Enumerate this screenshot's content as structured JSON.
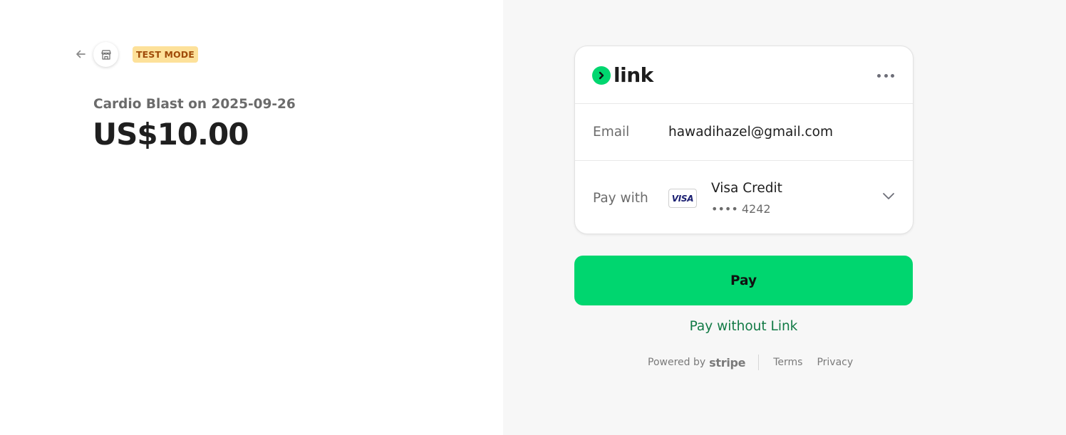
{
  "header": {
    "back_icon": "arrow-left-icon",
    "store_icon": "storefront-icon",
    "badge": "TEST MODE"
  },
  "summary": {
    "product": "Cardio Blast on 2025-09-26",
    "amount": "US$10.00"
  },
  "link_card": {
    "logo_text": "link",
    "menu_icon": "more-dots-icon",
    "email_label": "Email",
    "email_value": "hawadihazel@gmail.com",
    "pay_with_label": "Pay with",
    "card_brand": "VISA",
    "card_name": "Visa Credit",
    "card_last4": "•••• 4242",
    "chevron_icon": "chevron-down-icon"
  },
  "actions": {
    "pay_label": "Pay",
    "pay_without_link": "Pay without Link"
  },
  "footer": {
    "powered_by": "Powered by",
    "brand": "stripe",
    "terms": "Terms",
    "privacy": "Privacy"
  },
  "colors": {
    "accent_green": "#00d66f",
    "link_text_green": "#117a45",
    "badge_bg": "#fde19a",
    "badge_text": "#a04b08"
  }
}
